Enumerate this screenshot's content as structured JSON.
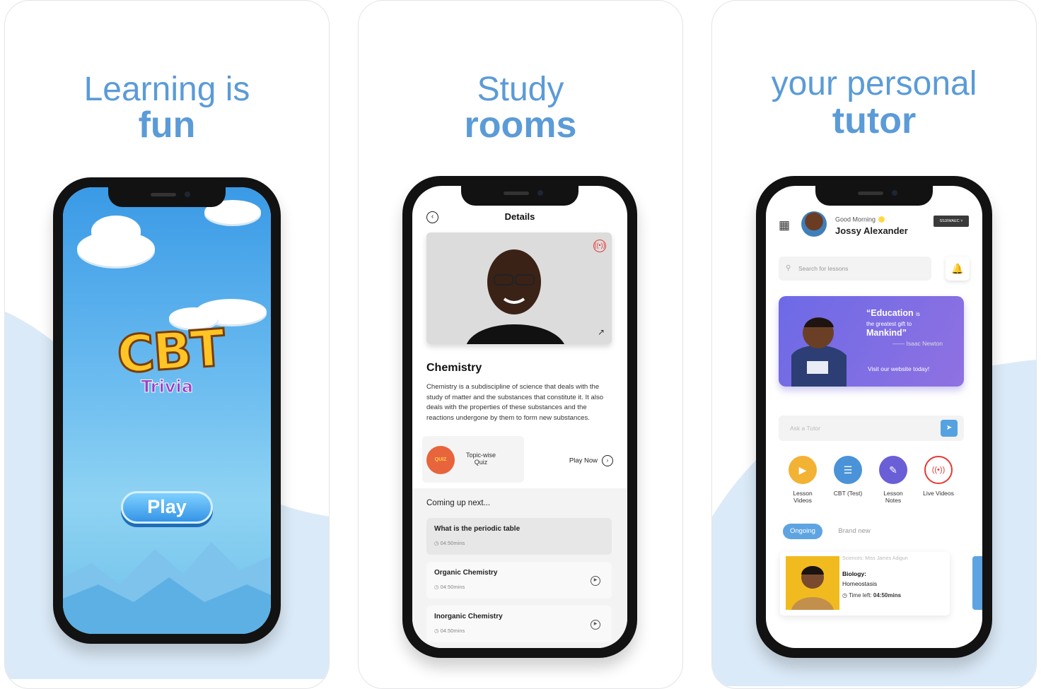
{
  "panel1": {
    "headline_top": "Learning is",
    "headline_bottom": "fun",
    "logo": "CBT",
    "sub": "Trivia",
    "play": "Play"
  },
  "panel2": {
    "headline_top": "Study",
    "headline_bottom": "rooms",
    "screen_title": "Details",
    "subject": "Chemistry",
    "description": "Chemistry is a subdiscipline of science that deals with the study of matter and the substances that constitute it. It also deals with the properties of these substances and the reactions undergone by them to form new substances.",
    "quiz_icon": "QUIZ",
    "quiz_label": "Topic-wise Quiz",
    "play_now": "Play Now",
    "coming": "Coming up next...",
    "lessons": [
      {
        "title": "What is the periodic table",
        "dur": "04:50mins"
      },
      {
        "title": "Organic Chemistry",
        "dur": "04:50mins"
      },
      {
        "title": "Inorganic Chemistry",
        "dur": "04:50mins"
      }
    ]
  },
  "panel3": {
    "headline_top": "your personal",
    "headline_bottom": "tutor",
    "greeting": "Good Morning",
    "name": "Jossy Alexander",
    "badge": "SS3/WAEC",
    "search_placeholder": "Search for lessons",
    "quote_a": "“Education",
    "quote_is": "is",
    "quote_b": "the greatest gift to",
    "quote_c": "Mankind”",
    "quote_author": "—— Isaac Newton",
    "visit": "Visit our website today!",
    "ask_placeholder": "Ask a Tutor",
    "features": [
      {
        "label": "Lesson Videos",
        "color": "#f2b234"
      },
      {
        "label": "CBT (Test)",
        "color": "#4a93d8"
      },
      {
        "label": "Lesson Notes",
        "color": "#6a5fd6"
      },
      {
        "label": "Live Videos",
        "color": "#e53935"
      }
    ],
    "tab_active": "Ongoing",
    "tab_other": "Brand new",
    "card": {
      "meta": "Sciences: Miss James Adigun",
      "subject": "Biology:",
      "topic": "Homeostasis",
      "time_label": "Time left:",
      "time": "04:50mins"
    }
  },
  "colors": {
    "headline": "#5b9bd7",
    "accent": "#5ea4e3"
  }
}
